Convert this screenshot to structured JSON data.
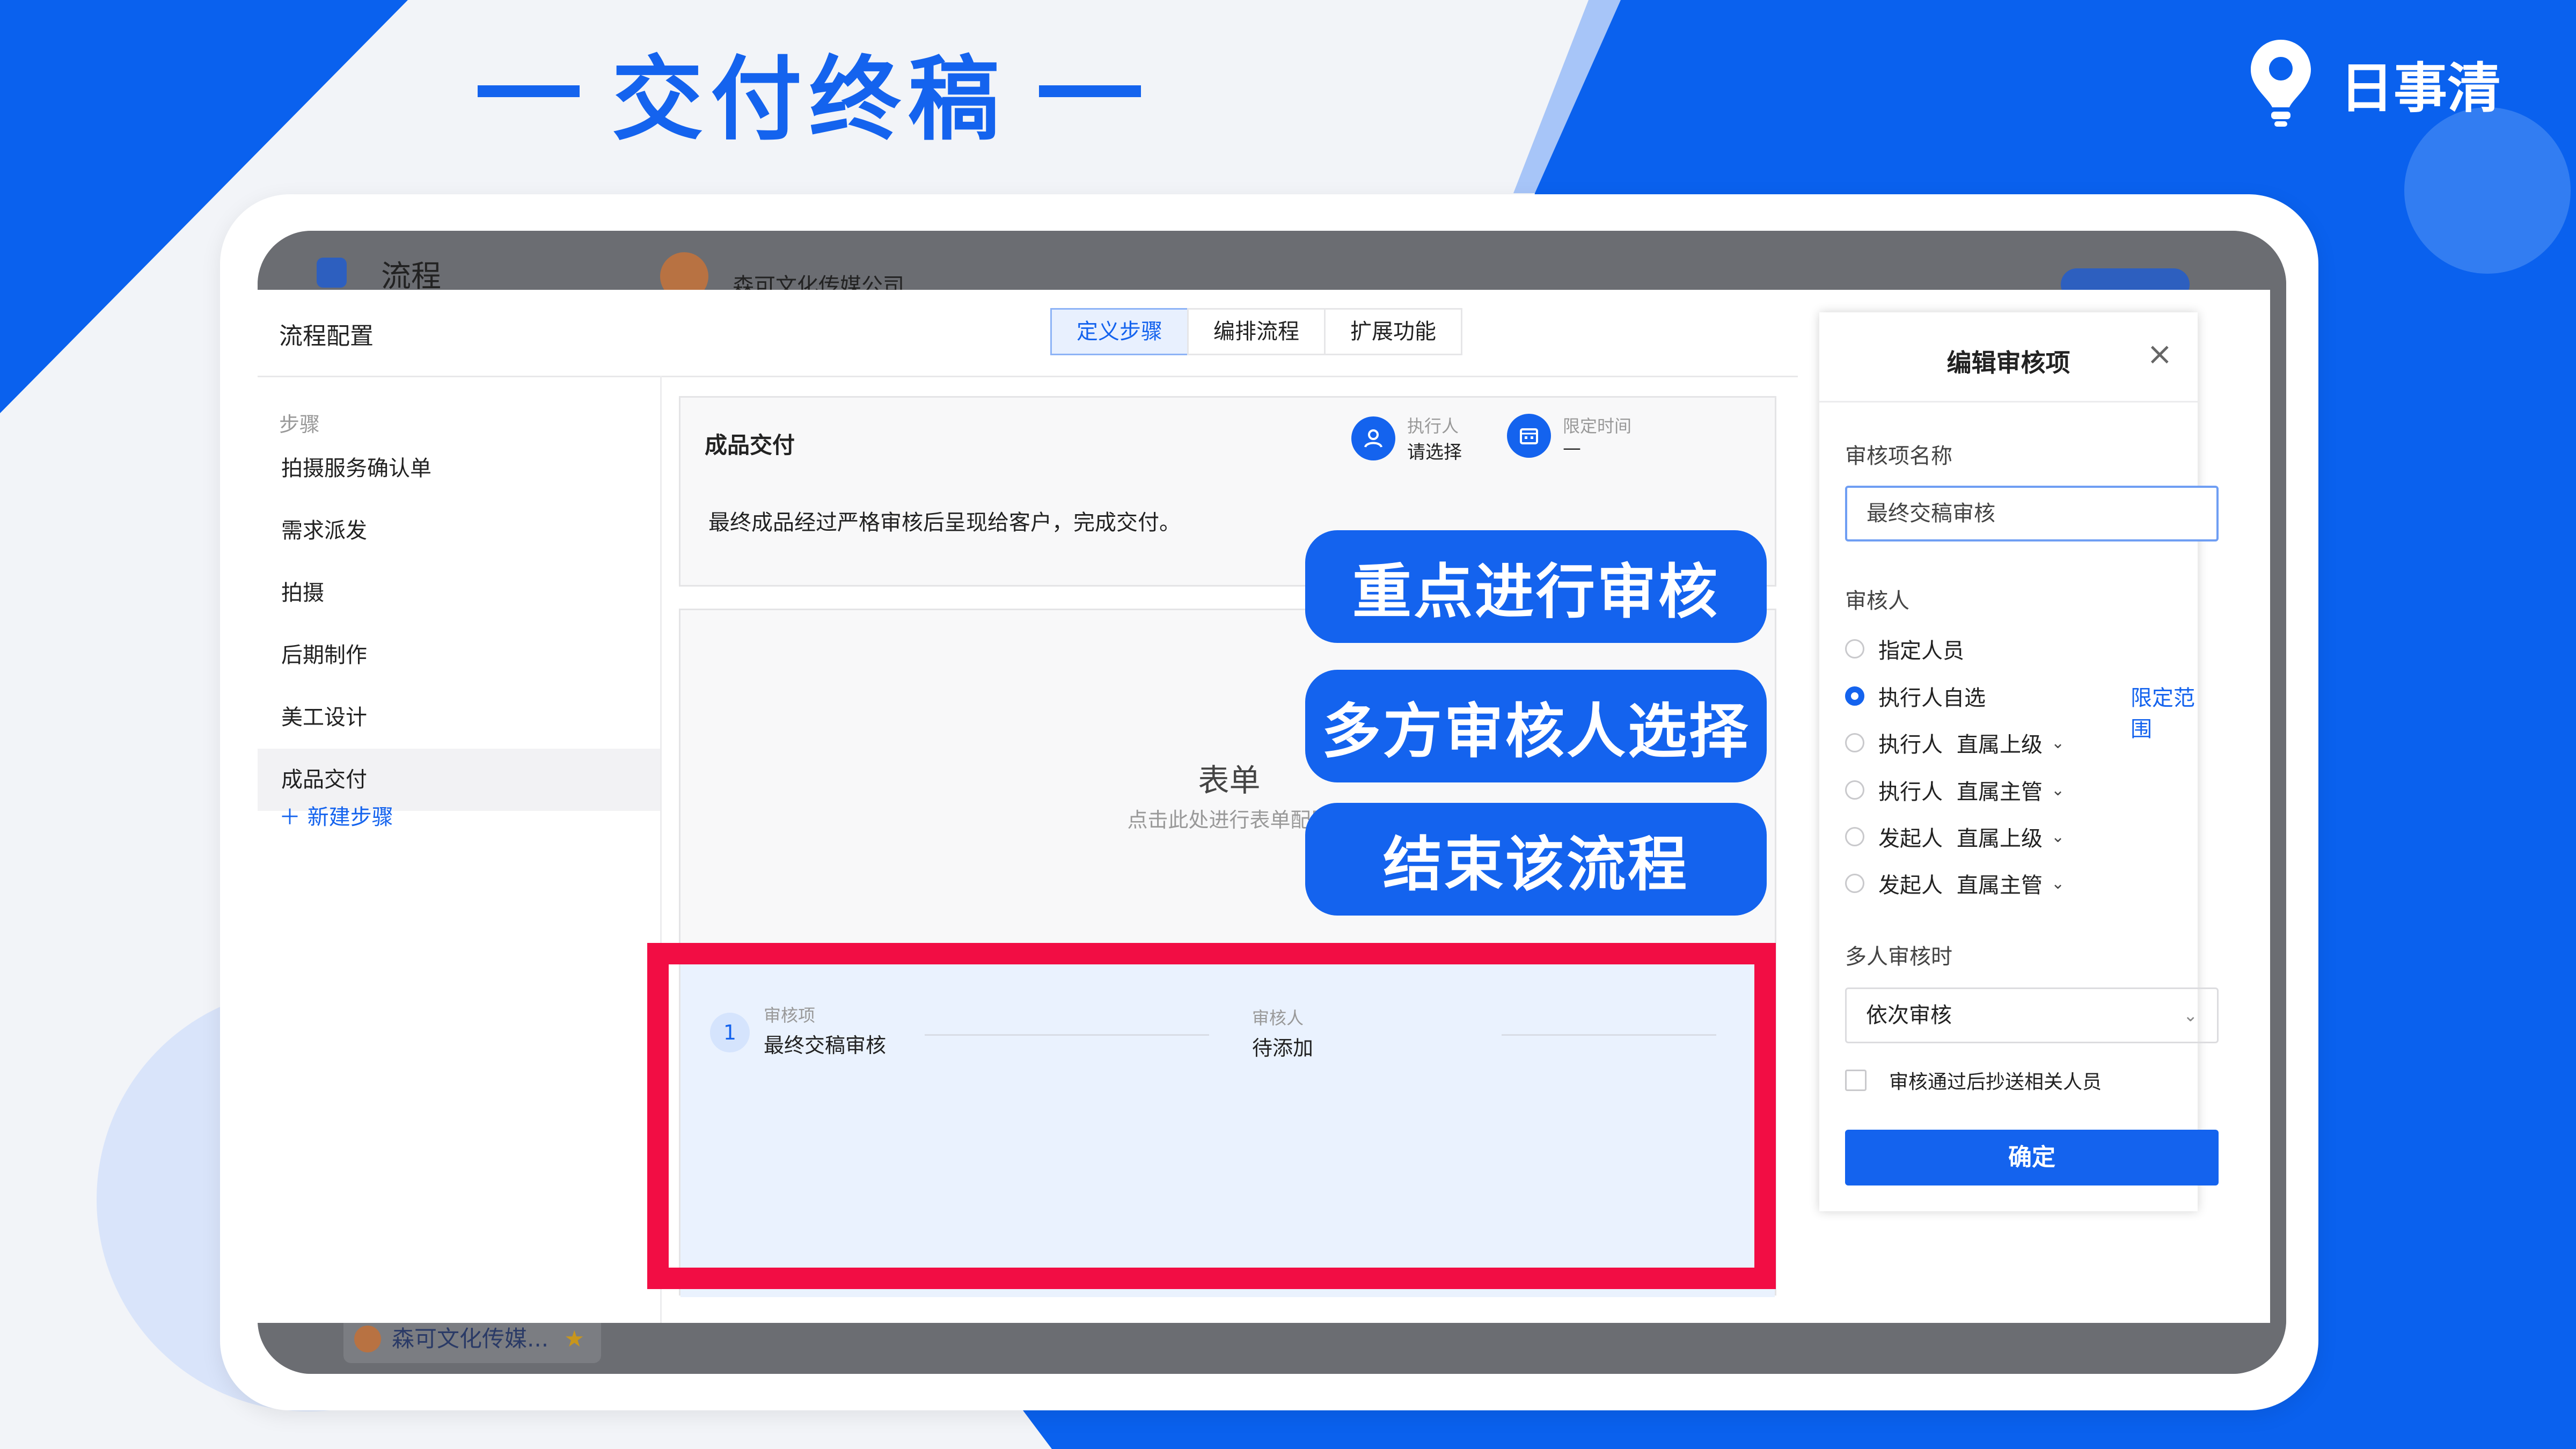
{
  "header": {
    "title": "交付终稿",
    "logo_text": "日事清"
  },
  "behind": {
    "top_left_text": "流程",
    "top_company": "森可文化传媒公司",
    "bottom_chip": "森可文化传媒..."
  },
  "window": {
    "title": "流程配置",
    "tabs": [
      {
        "label": "定义步骤",
        "active": true
      },
      {
        "label": "编排流程"
      },
      {
        "label": "扩展功能"
      }
    ]
  },
  "sidebar": {
    "label": "步骤",
    "items": [
      {
        "label": "拍摄服务确认单"
      },
      {
        "label": "需求派发"
      },
      {
        "label": "拍摄"
      },
      {
        "label": "后期制作"
      },
      {
        "label": "美工设计"
      },
      {
        "label": "成品交付",
        "active": true
      }
    ],
    "new_step": "新建步骤"
  },
  "step": {
    "name": "成品交付",
    "description": "最终成品经过严格审核后呈现给客户，完成交付。",
    "executor_label": "执行人",
    "executor_value": "请选择",
    "deadline_label": "限定时间",
    "deadline_value": "—"
  },
  "form": {
    "title": "表单",
    "subtitle": "点击此处进行表单配置"
  },
  "review": {
    "number": "1",
    "item_label": "审核项",
    "item_value": "最终交稿审核",
    "reviewer_label": "审核人",
    "reviewer_value": "待添加"
  },
  "overlays": [
    "重点进行审核",
    "多方审核人选择",
    "结束该流程"
  ],
  "panel": {
    "title": "编辑审核项",
    "close": "×",
    "name_label": "审核项名称",
    "name_value": "最终交稿审核",
    "reviewer_label": "审核人",
    "options": [
      {
        "label": "指定人员",
        "sub": ""
      },
      {
        "label": "执行人自选",
        "sub": "",
        "selected": true
      },
      {
        "label": "执行人",
        "sub": "直属上级"
      },
      {
        "label": "执行人",
        "sub": "直属主管"
      },
      {
        "label": "发起人",
        "sub": "直属上级"
      },
      {
        "label": "发起人",
        "sub": "直属主管"
      }
    ],
    "range_link": "限定范围",
    "multi_label": "多人审核时",
    "multi_value": "依次审核",
    "cc_label": "审核通过后抄送相关人员",
    "confirm": "确定"
  },
  "colors": {
    "brand_blue": "#1463ee",
    "highlight_red": "#f20d44"
  }
}
